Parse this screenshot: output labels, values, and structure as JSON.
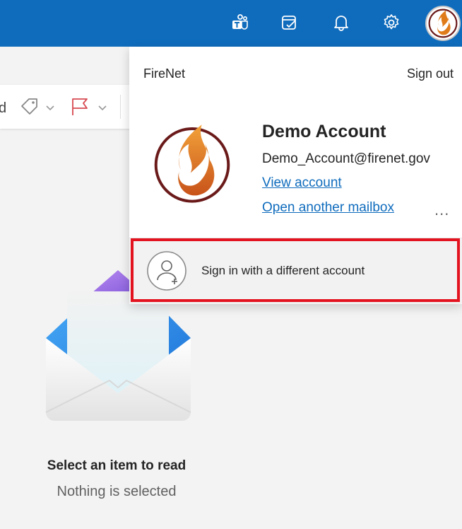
{
  "toolbar": {
    "partial_label": "d"
  },
  "account_panel": {
    "org_name": "FireNet",
    "sign_out_label": "Sign out",
    "account_name": "Demo Account",
    "account_email": "Demo_Account@firenet.gov",
    "view_account_label": "View account",
    "open_mailbox_label": "Open another mailbox",
    "more_label": "...",
    "sign_in_different_label": "Sign in with a different account"
  },
  "reading_pane": {
    "empty_title": "Select an item to read",
    "empty_subtitle": "Nothing is selected"
  },
  "icons": {
    "topbar": [
      "teams-icon",
      "todo-icon",
      "bell-icon",
      "gear-icon",
      "avatar"
    ],
    "toolbar": [
      "tag-icon",
      "flag-icon"
    ]
  },
  "colors": {
    "brand_blue": "#0f6cbd",
    "highlight_red": "#e3131f",
    "flame_orange": "#e07b1a",
    "logo_ring": "#6b1a1a"
  }
}
